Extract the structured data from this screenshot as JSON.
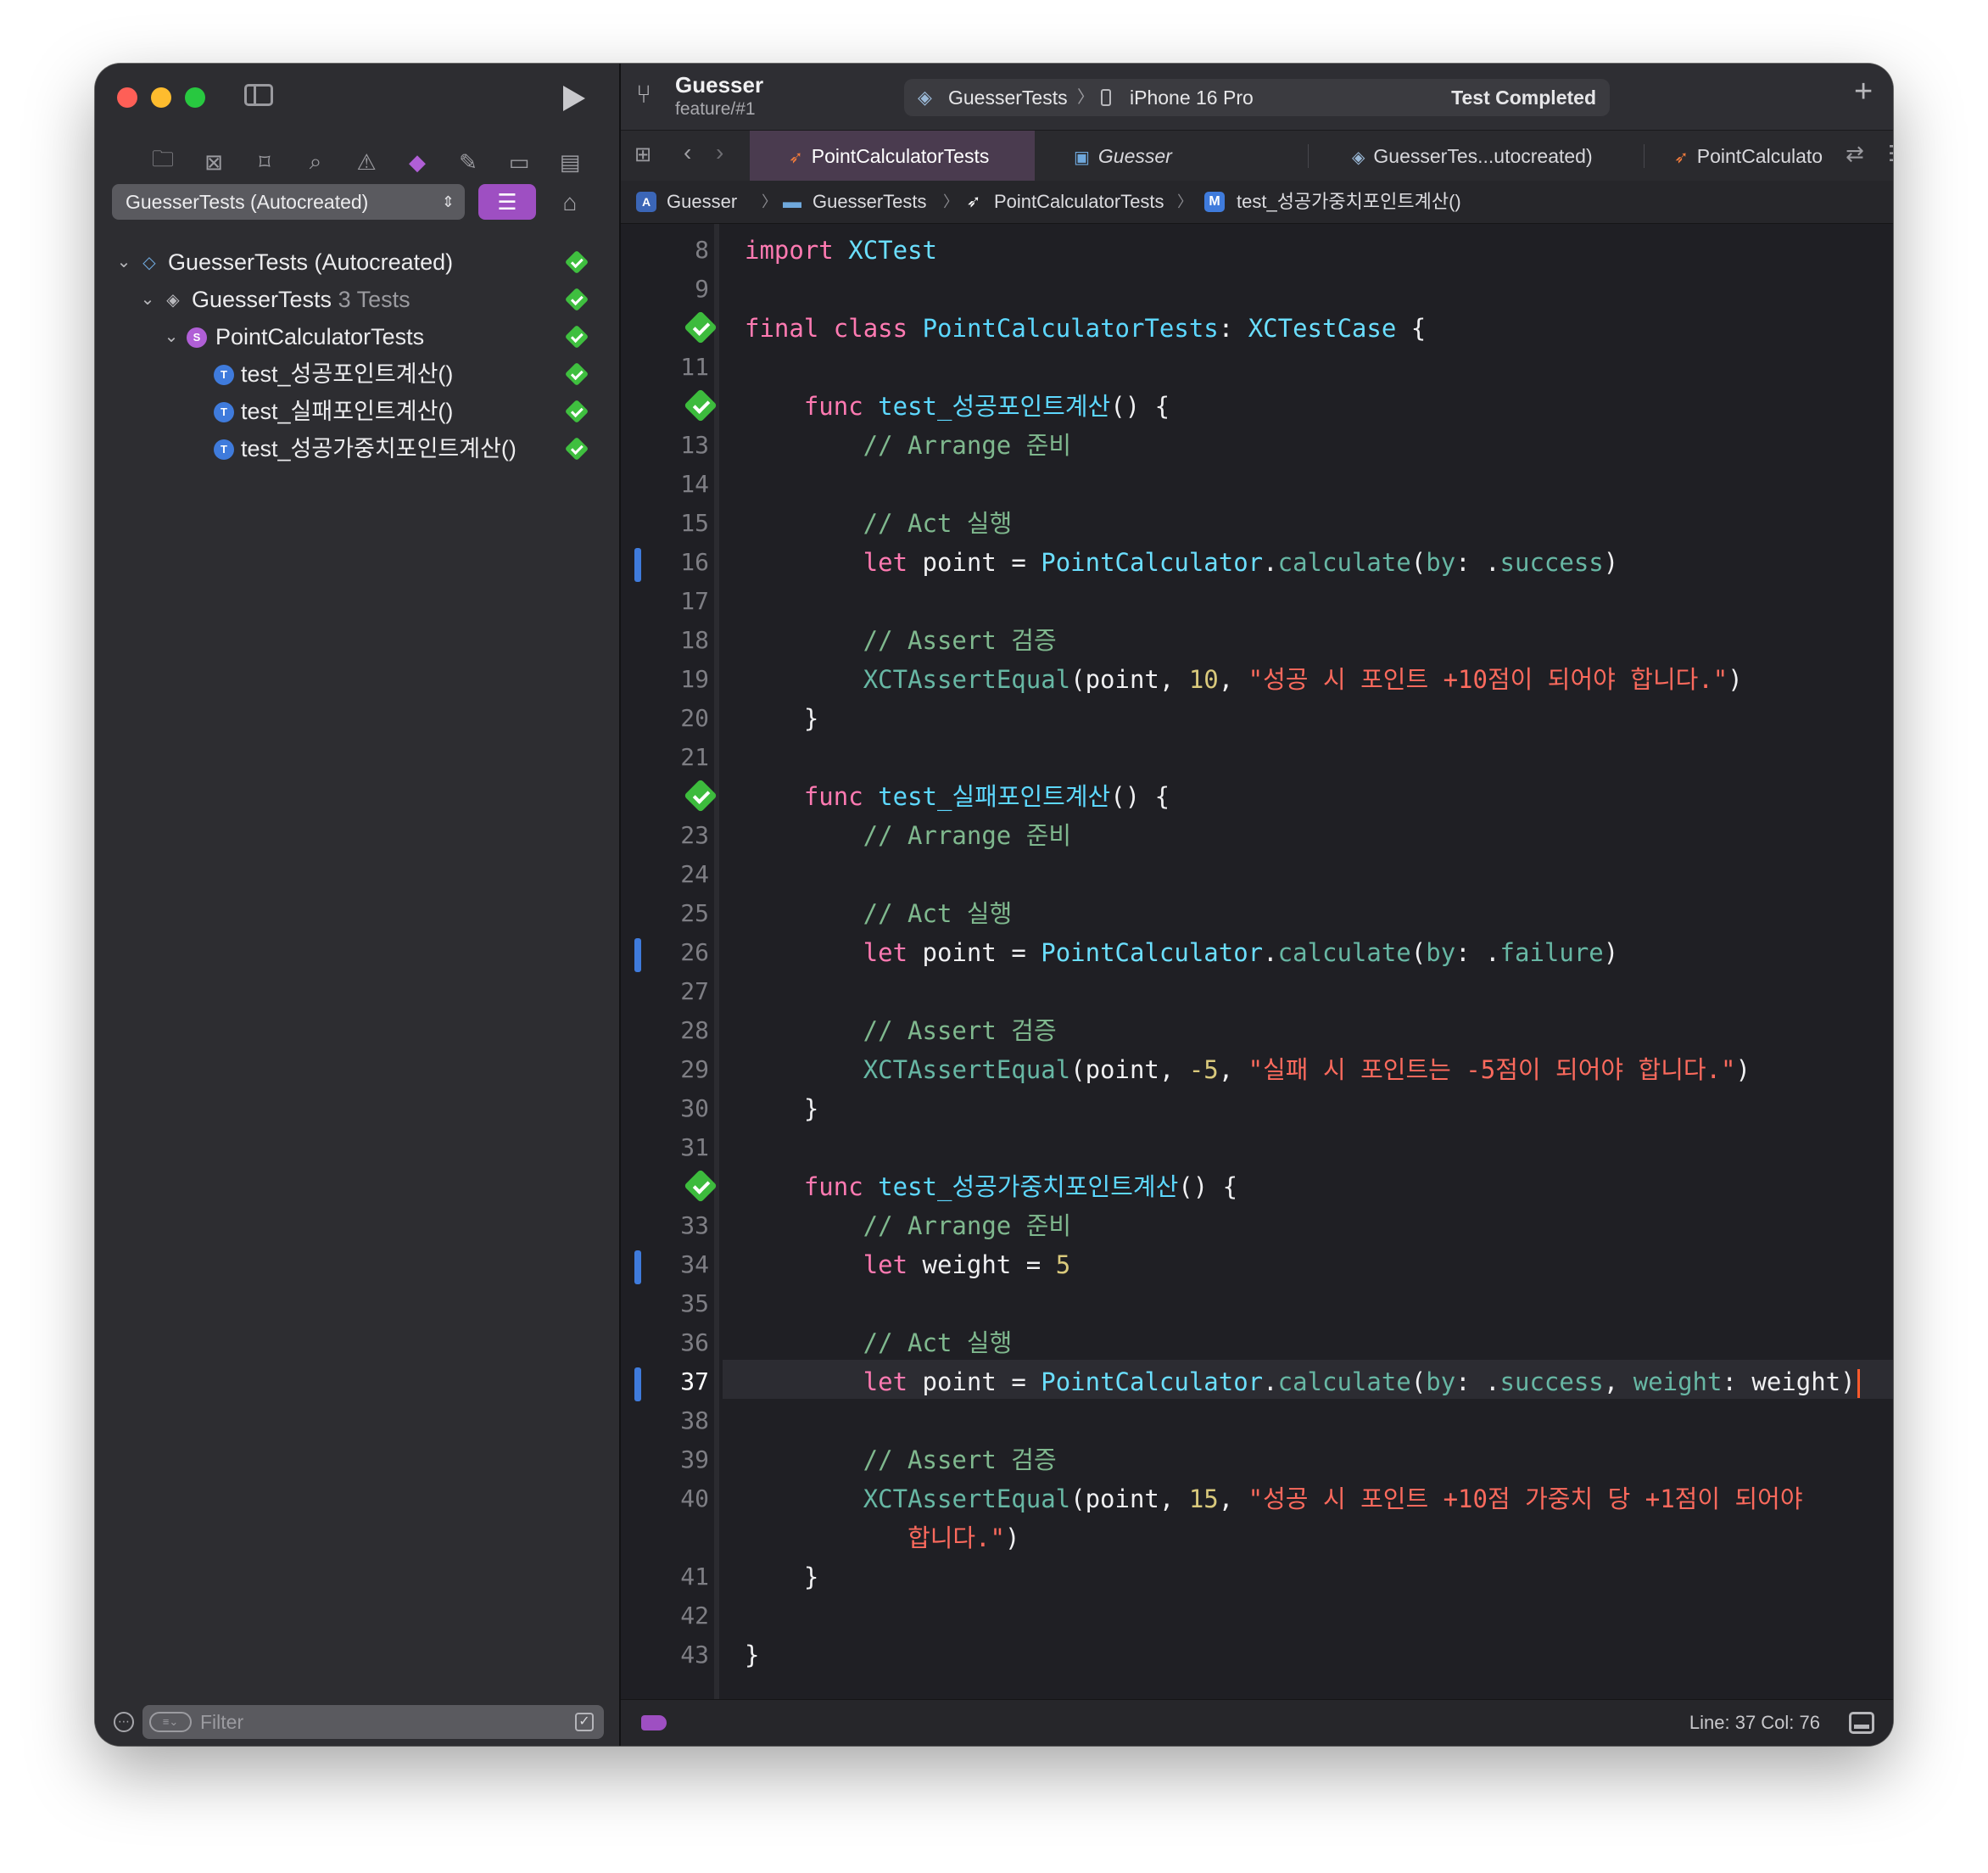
{
  "window": {
    "project": "Guesser",
    "branch": "feature/#1",
    "activity": {
      "scheme": "GuesserTests",
      "separator": "〉",
      "device": "iPhone 16 Pro",
      "status": "Test Completed"
    }
  },
  "navigator": {
    "scheme_select": "GuesserTests (Autocreated)",
    "tree": [
      {
        "label": "GuesserTests (Autocreated)",
        "sub": "",
        "status": "passed"
      },
      {
        "label": "GuesserTests",
        "sub": "3 Tests",
        "status": "passed"
      },
      {
        "label": "PointCalculatorTests",
        "sub": "",
        "status": "passed"
      },
      {
        "label": "test_성공포인트계산()",
        "sub": "",
        "status": "passed"
      },
      {
        "label": "test_실패포인트계산()",
        "sub": "",
        "status": "passed"
      },
      {
        "label": "test_성공가중치포인트계산()",
        "sub": "",
        "status": "passed"
      }
    ],
    "filter_placeholder": "Filter"
  },
  "tabs": [
    {
      "label": "PointCalculatorTests",
      "icon": "swift-icon",
      "active": true
    },
    {
      "label": "Guesser",
      "icon": "app-icon",
      "active": false
    },
    {
      "label": "GuesserTes...utocreated)",
      "icon": "test-plan-icon",
      "active": false
    },
    {
      "label": "PointCalculato",
      "icon": "swift-icon",
      "active": false
    }
  ],
  "jumpbar": [
    {
      "label": "Guesser",
      "icon": "app-icon"
    },
    {
      "label": "GuesserTests",
      "icon": "folder-icon"
    },
    {
      "label": "PointCalculatorTests",
      "icon": "swift-icon"
    },
    {
      "label": "test_성공가중치포인트계산()",
      "icon": "M"
    }
  ],
  "code": {
    "current_line": 37,
    "lines": [
      {
        "n": "8",
        "t": "import XCTest"
      },
      {
        "n": "9",
        "t": ""
      },
      {
        "n": "10",
        "t": "final class PointCalculatorTests: XCTestCase {"
      },
      {
        "n": "11",
        "t": ""
      },
      {
        "n": "12",
        "t": "    func test_성공포인트계산() {"
      },
      {
        "n": "13",
        "t": "        // Arrange 준비"
      },
      {
        "n": "14",
        "t": ""
      },
      {
        "n": "15",
        "t": "        // Act 실행"
      },
      {
        "n": "16",
        "t": "        let point = PointCalculator.calculate(by: .success)"
      },
      {
        "n": "17",
        "t": ""
      },
      {
        "n": "18",
        "t": "        // Assert 검증"
      },
      {
        "n": "19",
        "t": "        XCTAssertEqual(point, 10, \"성공 시 포인트 +10점이 되어야 합니다.\")"
      },
      {
        "n": "20",
        "t": "    }"
      },
      {
        "n": "21",
        "t": ""
      },
      {
        "n": "22",
        "t": "    func test_실패포인트계산() {"
      },
      {
        "n": "23",
        "t": "        // Arrange 준비"
      },
      {
        "n": "24",
        "t": ""
      },
      {
        "n": "25",
        "t": "        // Act 실행"
      },
      {
        "n": "26",
        "t": "        let point = PointCalculator.calculate(by: .failure)"
      },
      {
        "n": "27",
        "t": ""
      },
      {
        "n": "28",
        "t": "        // Assert 검증"
      },
      {
        "n": "29",
        "t": "        XCTAssertEqual(point, -5, \"실패 시 포인트는 -5점이 되어야 합니다.\")"
      },
      {
        "n": "30",
        "t": "    }"
      },
      {
        "n": "31",
        "t": ""
      },
      {
        "n": "32",
        "t": "    func test_성공가중치포인트계산() {"
      },
      {
        "n": "33",
        "t": "        // Arrange 준비"
      },
      {
        "n": "34",
        "t": "        let weight = 5"
      },
      {
        "n": "35",
        "t": ""
      },
      {
        "n": "36",
        "t": "        // Act 실행"
      },
      {
        "n": "37",
        "t": "        let point = PointCalculator.calculate(by: .success, weight: weight)"
      },
      {
        "n": "38",
        "t": ""
      },
      {
        "n": "39",
        "t": "        // Assert 검증"
      },
      {
        "n": "40",
        "t": "        XCTAssertEqual(point, 15, \"성공 시 포인트 +10점 가중치 당 +1점이 되어야"
      },
      {
        "n": "",
        "t": "           합니다.\")"
      },
      {
        "n": "41",
        "t": "    }"
      },
      {
        "n": "42",
        "t": ""
      },
      {
        "n": "43",
        "t": "}"
      }
    ],
    "passed_test_lines": [
      "10",
      "12",
      "22",
      "32"
    ],
    "changed_lines": [
      "16",
      "26",
      "34",
      "37"
    ]
  },
  "statusbar": {
    "position": "Line: 37  Col: 76"
  },
  "colors": {
    "keyword": "#ff7ab2",
    "type": "#6bdfff",
    "comment": "#7fb88e",
    "string": "#fc6a5d",
    "number": "#d9c97c",
    "accent": "#9e4fc2",
    "pass": "#3dbb3d"
  }
}
